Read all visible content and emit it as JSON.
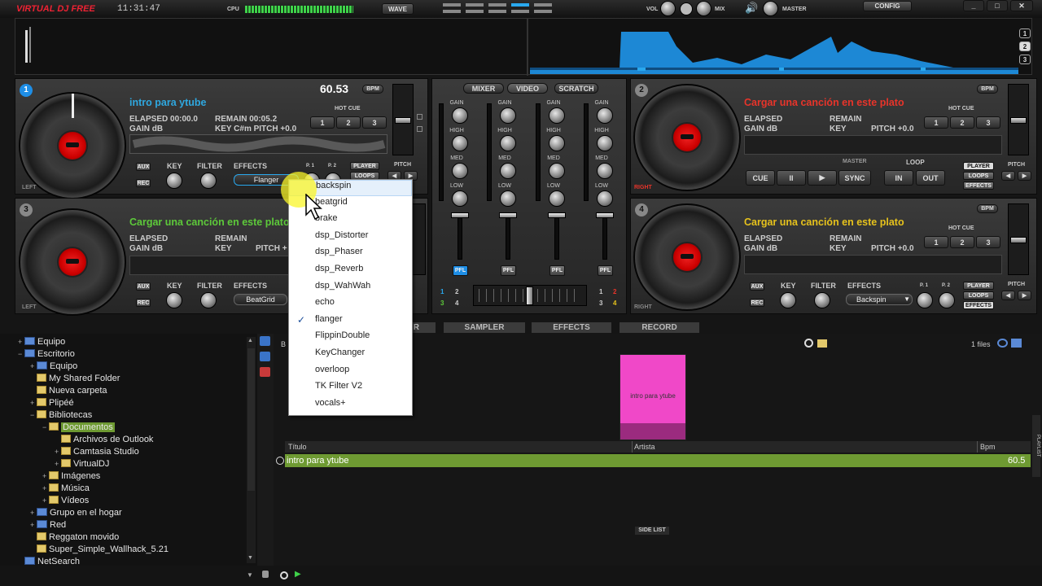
{
  "topbar": {
    "logo": "VIRTUAL DJ FREE",
    "clock": "11:31:47",
    "cpu_label": "CPU",
    "wave_button": "WAVE",
    "vol_label": "VOL",
    "mix_label": "MIX",
    "master_label": "MASTER",
    "config_button": "CONFIG",
    "window_controls": [
      "_",
      "□",
      "✕"
    ]
  },
  "overview": {
    "deck_numbers": [
      "1",
      "2",
      "3"
    ]
  },
  "deck1": {
    "number": "1",
    "bpm_value": "60.53",
    "bpm_label": "BPM",
    "title": "intro para ytube",
    "title_color": "#2fa8e0",
    "elapsed": "ELAPSED 00:00.0",
    "remain": "REMAIN 00:05.2",
    "gain": "GAIN dB",
    "key_pitch": "KEY C#m PITCH +0.0",
    "hot_cue_label": "HOT CUE",
    "hot_cues": [
      "1",
      "2",
      "3"
    ],
    "side_label": "LEFT",
    "knob_labels": [
      "KEY",
      "FILTER"
    ],
    "effects_label": "EFFECTS",
    "effect_selected": "Flanger",
    "p1": "P. 1",
    "p2": "P. 2",
    "mode_buttons": [
      "PLAYER",
      "LOOPS"
    ],
    "pitch_label": "PITCH",
    "aux": "AUX",
    "rec": "REC"
  },
  "deck2": {
    "number": "2",
    "bpm_label": "BPM",
    "title": "Cargar una canción en este plato",
    "title_color": "#e8342a",
    "elapsed": "ELAPSED",
    "remain": "REMAIN",
    "gain": "GAIN dB",
    "key": "KEY",
    "pitch": "PITCH +0.0",
    "hot_cue_label": "HOT CUE",
    "hot_cues": [
      "1",
      "2",
      "3"
    ],
    "side_label": "RIGHT",
    "master_label": "MASTER",
    "loop_label": "LOOP",
    "transport": [
      "CUE",
      "II",
      "▶",
      "SYNC"
    ],
    "loop_buttons": [
      "IN",
      "OUT"
    ],
    "mode_buttons": [
      "PLAYER",
      "LOOPS",
      "EFFECTS"
    ],
    "pitch_label": "PITCH"
  },
  "deck3": {
    "number": "3",
    "title": "Cargar una canción en este plato",
    "title_color": "#5dc93a",
    "elapsed": "ELAPSED",
    "remain": "REMAIN",
    "gain": "GAIN dB",
    "key": "KEY",
    "pitch": "PITCH +",
    "side_label": "LEFT",
    "knob_labels": [
      "KEY",
      "FILTER"
    ],
    "effects_label": "EFFECTS",
    "effect_selected": "BeatGrid",
    "aux": "AUX",
    "rec": "REC"
  },
  "deck4": {
    "number": "4",
    "bpm_label": "BPM",
    "title": "Cargar una canción en este plato",
    "title_color": "#e6c21c",
    "elapsed": "ELAPSED",
    "remain": "REMAIN",
    "gain": "GAIN dB",
    "key": "KEY",
    "pitch": "PITCH +0.0",
    "hot_cue_label": "HOT CUE",
    "hot_cues": [
      "1",
      "2",
      "3"
    ],
    "side_label": "RIGHT",
    "knob_labels": [
      "KEY",
      "FILTER"
    ],
    "effects_label": "EFFECTS",
    "effect_selected": "Backspin",
    "p1": "P. 1",
    "p2": "P. 2",
    "mode_buttons": [
      "PLAYER",
      "LOOPS",
      "EFFECTS"
    ],
    "pitch_label": "PITCH",
    "aux": "AUX",
    "rec": "REC"
  },
  "mixer": {
    "tabs": [
      "MIXER",
      "VIDEO",
      "SCRATCH"
    ],
    "eq_labels": [
      "GAIN",
      "HIGH",
      "MED",
      "LOW"
    ],
    "pfl": "PFL",
    "cross_left": [
      "1",
      "2",
      "3",
      "4"
    ],
    "cross_right": [
      "1",
      "2",
      "3",
      "4"
    ]
  },
  "effects_menu": {
    "items": [
      "backspin",
      "beatgrid",
      "brake",
      "dsp_Distorter",
      "dsp_Phaser",
      "dsp_Reverb",
      "dsp_WahWah",
      "echo",
      "flanger",
      "FlippinDouble",
      "KeyChanger",
      "overloop",
      "TK Filter V2",
      "vocals+"
    ],
    "checked": "flanger",
    "check_mark": "✓"
  },
  "browser": {
    "tabs": [
      "R",
      "SAMPLER",
      "EFFECTS",
      "RECORD"
    ],
    "search_prefix": "B",
    "files_count": "1 files",
    "tree": [
      {
        "label": "Equipo",
        "icon": "pc",
        "indent": 0,
        "exp": "+"
      },
      {
        "label": "Escritorio",
        "icon": "pc",
        "indent": 0,
        "exp": "−"
      },
      {
        "label": "Equipo",
        "icon": "pc",
        "indent": 1,
        "exp": "+"
      },
      {
        "label": "My Shared Folder",
        "icon": "folder",
        "indent": 1,
        "exp": ""
      },
      {
        "label": "Nueva carpeta",
        "icon": "folder",
        "indent": 1,
        "exp": ""
      },
      {
        "label": "Plipéé",
        "icon": "folder",
        "indent": 1,
        "exp": "+"
      },
      {
        "label": "Bibliotecas",
        "icon": "folder",
        "indent": 1,
        "exp": "−"
      },
      {
        "label": "Documentos",
        "icon": "folder",
        "indent": 2,
        "exp": "−",
        "selected": true
      },
      {
        "label": "Archivos de Outlook",
        "icon": "folder",
        "indent": 3,
        "exp": ""
      },
      {
        "label": "Camtasia Studio",
        "icon": "folder",
        "indent": 3,
        "exp": "+"
      },
      {
        "label": "VirtualDJ",
        "icon": "folder",
        "indent": 3,
        "exp": "+"
      },
      {
        "label": "Imágenes",
        "icon": "folder",
        "indent": 2,
        "exp": "+"
      },
      {
        "label": "Música",
        "icon": "folder",
        "indent": 2,
        "exp": "+"
      },
      {
        "label": "Vídeos",
        "icon": "folder",
        "indent": 2,
        "exp": "+"
      },
      {
        "label": "Grupo en el hogar",
        "icon": "pc",
        "indent": 1,
        "exp": "+"
      },
      {
        "label": "Red",
        "icon": "pc",
        "indent": 1,
        "exp": "+"
      },
      {
        "label": "Reggaton movido",
        "icon": "folder",
        "indent": 1,
        "exp": ""
      },
      {
        "label": "Super_Simple_Wallhack_5.21",
        "icon": "folder",
        "indent": 1,
        "exp": ""
      },
      {
        "label": "NetSearch",
        "icon": "pc",
        "indent": 0,
        "exp": ""
      }
    ],
    "cover_text": "intro para ytube",
    "columns": [
      "Título",
      "Artista",
      "Bpm"
    ],
    "rows": [
      {
        "title": "intro para ytube",
        "artist": "",
        "bpm": "60.5"
      }
    ],
    "side_list": "SIDE LIST",
    "playlist": "PLAYLIST"
  }
}
